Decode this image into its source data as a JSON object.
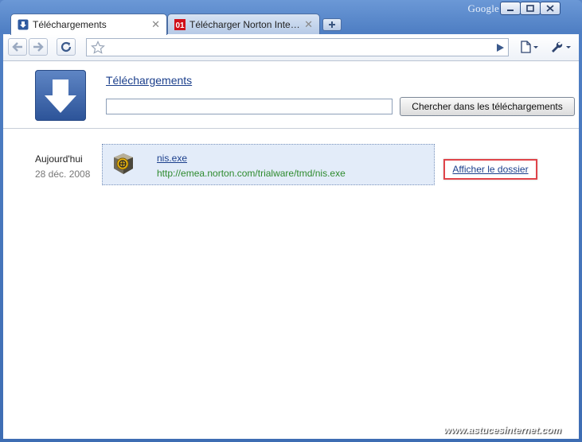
{
  "window": {
    "brand_label": "Google",
    "controls": {
      "minimize": "minimize-icon",
      "maximize": "maximize-icon",
      "close": "close-icon"
    }
  },
  "tabs": [
    {
      "title": "Téléchargements",
      "icon": "download-arrow-icon",
      "active": true
    },
    {
      "title": "Télécharger Norton Intern…",
      "icon": "01net-icon",
      "icon_text": "01",
      "active": false
    }
  ],
  "toolbar": {
    "back": "back-arrow-icon",
    "forward": "forward-arrow-icon",
    "reload": "reload-icon",
    "bookmark": "star-icon",
    "address_value": "",
    "go": "play-icon",
    "page_menu": "page-icon",
    "tools_menu": "wrench-icon"
  },
  "downloads_page": {
    "title": "Téléchargements",
    "search_value": "",
    "search_button": "Chercher dans les téléchargements",
    "group": {
      "day_label": "Aujourd'hui",
      "date": "28 déc. 2008",
      "items": [
        {
          "filename": "nis.exe",
          "url": "http://emea.norton.com/trialware/tmd/nis.exe",
          "action": "Afficher le dossier"
        }
      ]
    }
  },
  "watermark": "www.astucesinternet.com",
  "colors": {
    "frame": "#4f7fc4",
    "link": "#1b3f8c",
    "url_green": "#2e8b2e",
    "highlight": "#e0444a",
    "item_bg": "#e3ecf9"
  }
}
